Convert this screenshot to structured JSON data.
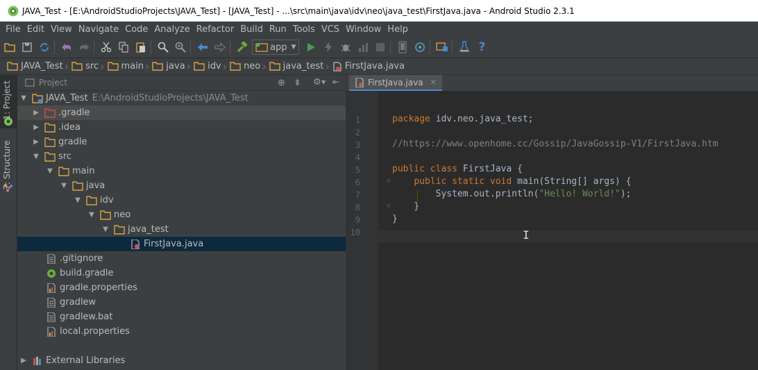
{
  "window": {
    "title": "JAVA_Test - [E:\\AndroidStudioProjects\\JAVA_Test] - [JAVA_Test] - ...\\src\\main\\java\\idv\\neo\\java_test\\FirstJava.java - Android Studio 2.3.1"
  },
  "menu": [
    "File",
    "Edit",
    "View",
    "Navigate",
    "Code",
    "Analyze",
    "Refactor",
    "Build",
    "Run",
    "Tools",
    "VCS",
    "Window",
    "Help"
  ],
  "toolbar": {
    "run_config": "app",
    "help_label": "?"
  },
  "breadcrumb": [
    "JAVA_Test",
    "src",
    "main",
    "java",
    "idv",
    "neo",
    "java_test",
    "FirstJava.java"
  ],
  "side_tabs": {
    "project": "1: Project",
    "structure": "7: Structure"
  },
  "project_panel": {
    "header": "Project",
    "root_name": "JAVA_Test",
    "root_path": "E:\\AndroidStudioProjects\\JAVA_Test",
    "items": [
      {
        "label": ".gradle"
      },
      {
        "label": ".idea"
      },
      {
        "label": "gradle"
      },
      {
        "label": "src"
      },
      {
        "label": "main"
      },
      {
        "label": "java"
      },
      {
        "label": "idv"
      },
      {
        "label": "neo"
      },
      {
        "label": "java_test"
      },
      {
        "label": "FirstJava.java"
      },
      {
        "label": ".gitignore"
      },
      {
        "label": "build.gradle"
      },
      {
        "label": "gradle.properties"
      },
      {
        "label": "gradlew"
      },
      {
        "label": "gradlew.bat"
      },
      {
        "label": "local.properties"
      },
      {
        "label": "External Libraries"
      }
    ]
  },
  "editor": {
    "tab_label": "FirstJava.java",
    "line_numbers": [
      "1",
      "2",
      "3",
      "4",
      "5",
      "6",
      "7",
      "8",
      "9",
      "10"
    ],
    "code": {
      "l1_kw": "package",
      "l1_rest": " idv.neo.java_test;",
      "l3_comment": "//https://www.openhome.cc/Gossip/JavaGossip-V1/FirstJava.htm",
      "l5_kw": "public class",
      "l5_rest": " FirstJava {",
      "l6_indent": "    ",
      "l6_kw": "public static void",
      "l6_rest": " main(String[] args) {",
      "l7_pre": "        System.out.println(",
      "l7_str": "\"Hello! World!\"",
      "l7_post": ");",
      "l8": "    }",
      "l9": "}"
    }
  },
  "colors": {
    "accent": "#4a88c7",
    "selection": "#0d293e",
    "keyword": "#cc7832",
    "string": "#6a8759",
    "comment": "#808080"
  }
}
